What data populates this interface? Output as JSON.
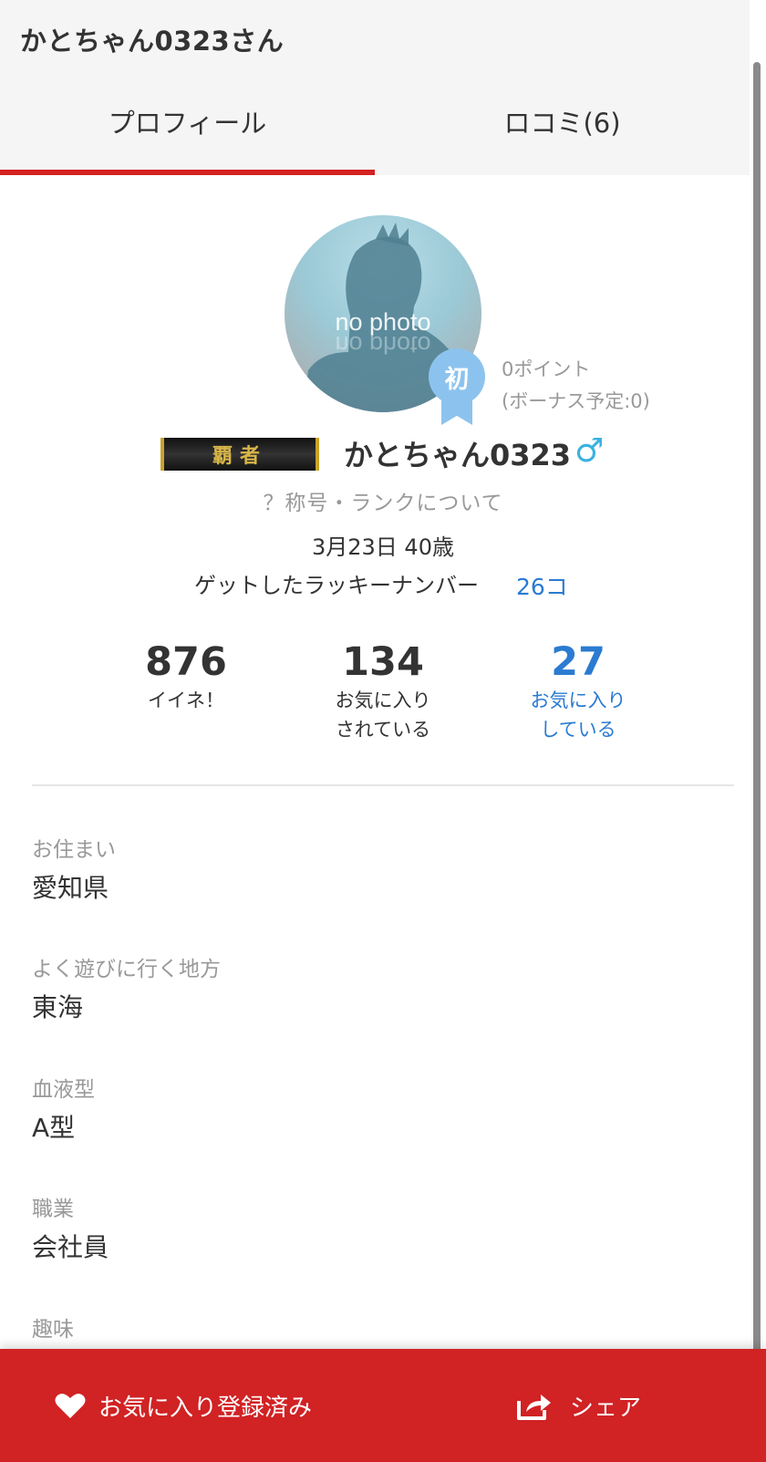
{
  "header": {
    "title": "かとちゃん0323さん"
  },
  "tabs": [
    {
      "label": "プロフィール",
      "active": true
    },
    {
      "label": "ロコミ(6)",
      "active": false
    }
  ],
  "profile": {
    "avatar_text": "no photo",
    "badge_text": "初",
    "points_line1": "0ポイント",
    "points_line2": "(ボーナス予定:0)",
    "rank_title": "覇者",
    "username": "かとちゃん0323",
    "gender_symbol": "♂",
    "rank_link": "？称号・ランクについて",
    "birth_age": "3月23日 40歳",
    "lucky_label": "ゲットしたラッキーナンバー",
    "lucky_count": "26コ"
  },
  "stats": [
    {
      "value": "876",
      "line1": "イイネ！",
      "line2": ""
    },
    {
      "value": "134",
      "line1": "お気に入り",
      "line2": "されている"
    },
    {
      "value": "27",
      "line1": "お気に入り",
      "line2": "している"
    }
  ],
  "fields": [
    {
      "label": "お住まい",
      "value": "愛知県"
    },
    {
      "label": "よく遊びに行く地方",
      "value": "東海"
    },
    {
      "label": "血液型",
      "value": "A型"
    },
    {
      "label": "職業",
      "value": "会社員"
    },
    {
      "label": "趣味",
      "value": ""
    }
  ],
  "bottom": {
    "favorite_label": "お気に入り登録済み",
    "share_label": "シェア"
  },
  "colors": {
    "accent_red": "#d12224",
    "link_blue": "#2a7bd1",
    "gender_blue": "#3ab2e0",
    "badge_blue": "#8cc3ee"
  },
  "icons": {
    "heart": "heart-icon",
    "share": "share-icon",
    "gender": "male-icon"
  }
}
